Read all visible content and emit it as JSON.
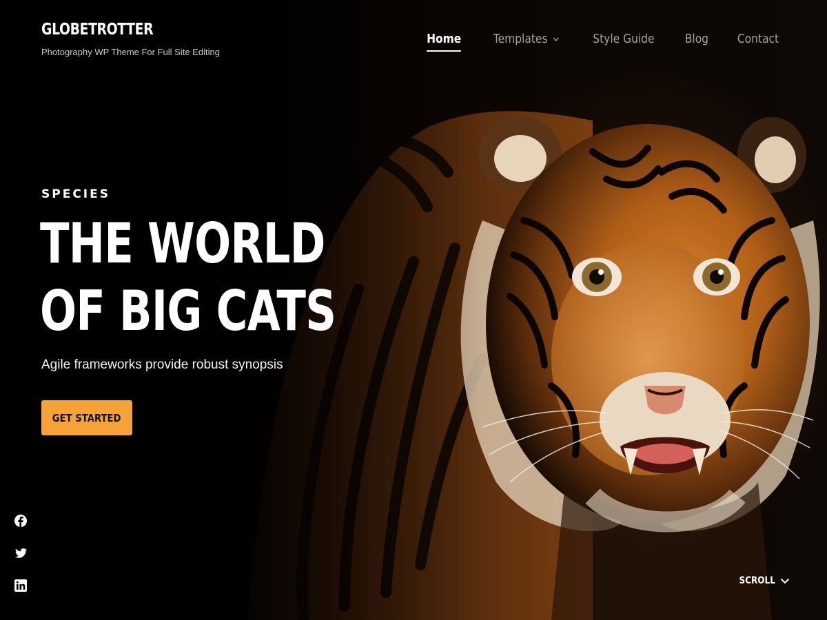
{
  "header": {
    "site_title": "GLOBETROTTER",
    "tagline": "Photography WP Theme For Full Site Editing",
    "nav": [
      {
        "label": "Home",
        "active": true,
        "has_dropdown": false
      },
      {
        "label": "Templates",
        "active": false,
        "has_dropdown": true
      },
      {
        "label": "Style Guide",
        "active": false,
        "has_dropdown": false
      },
      {
        "label": "Blog",
        "active": false,
        "has_dropdown": false
      },
      {
        "label": "Contact",
        "active": false,
        "has_dropdown": false
      }
    ]
  },
  "hero": {
    "eyebrow": "SPECIES",
    "headline_line1": "THE WORLD",
    "headline_line2": "OF BIG CATS",
    "subtitle": "Agile frameworks provide robust synopsis",
    "cta_label": "GET STARTED",
    "background_image": "tiger-photo"
  },
  "social": [
    {
      "icon": "facebook-icon"
    },
    {
      "icon": "twitter-icon"
    },
    {
      "icon": "linkedin-icon"
    }
  ],
  "scroll": {
    "label": "SCROLL",
    "icon": "chevron-down-icon"
  },
  "colors": {
    "accent": "#f7a239",
    "background": "#000000",
    "text": "#ffffff",
    "nav_inactive": "#a3a3a3"
  }
}
